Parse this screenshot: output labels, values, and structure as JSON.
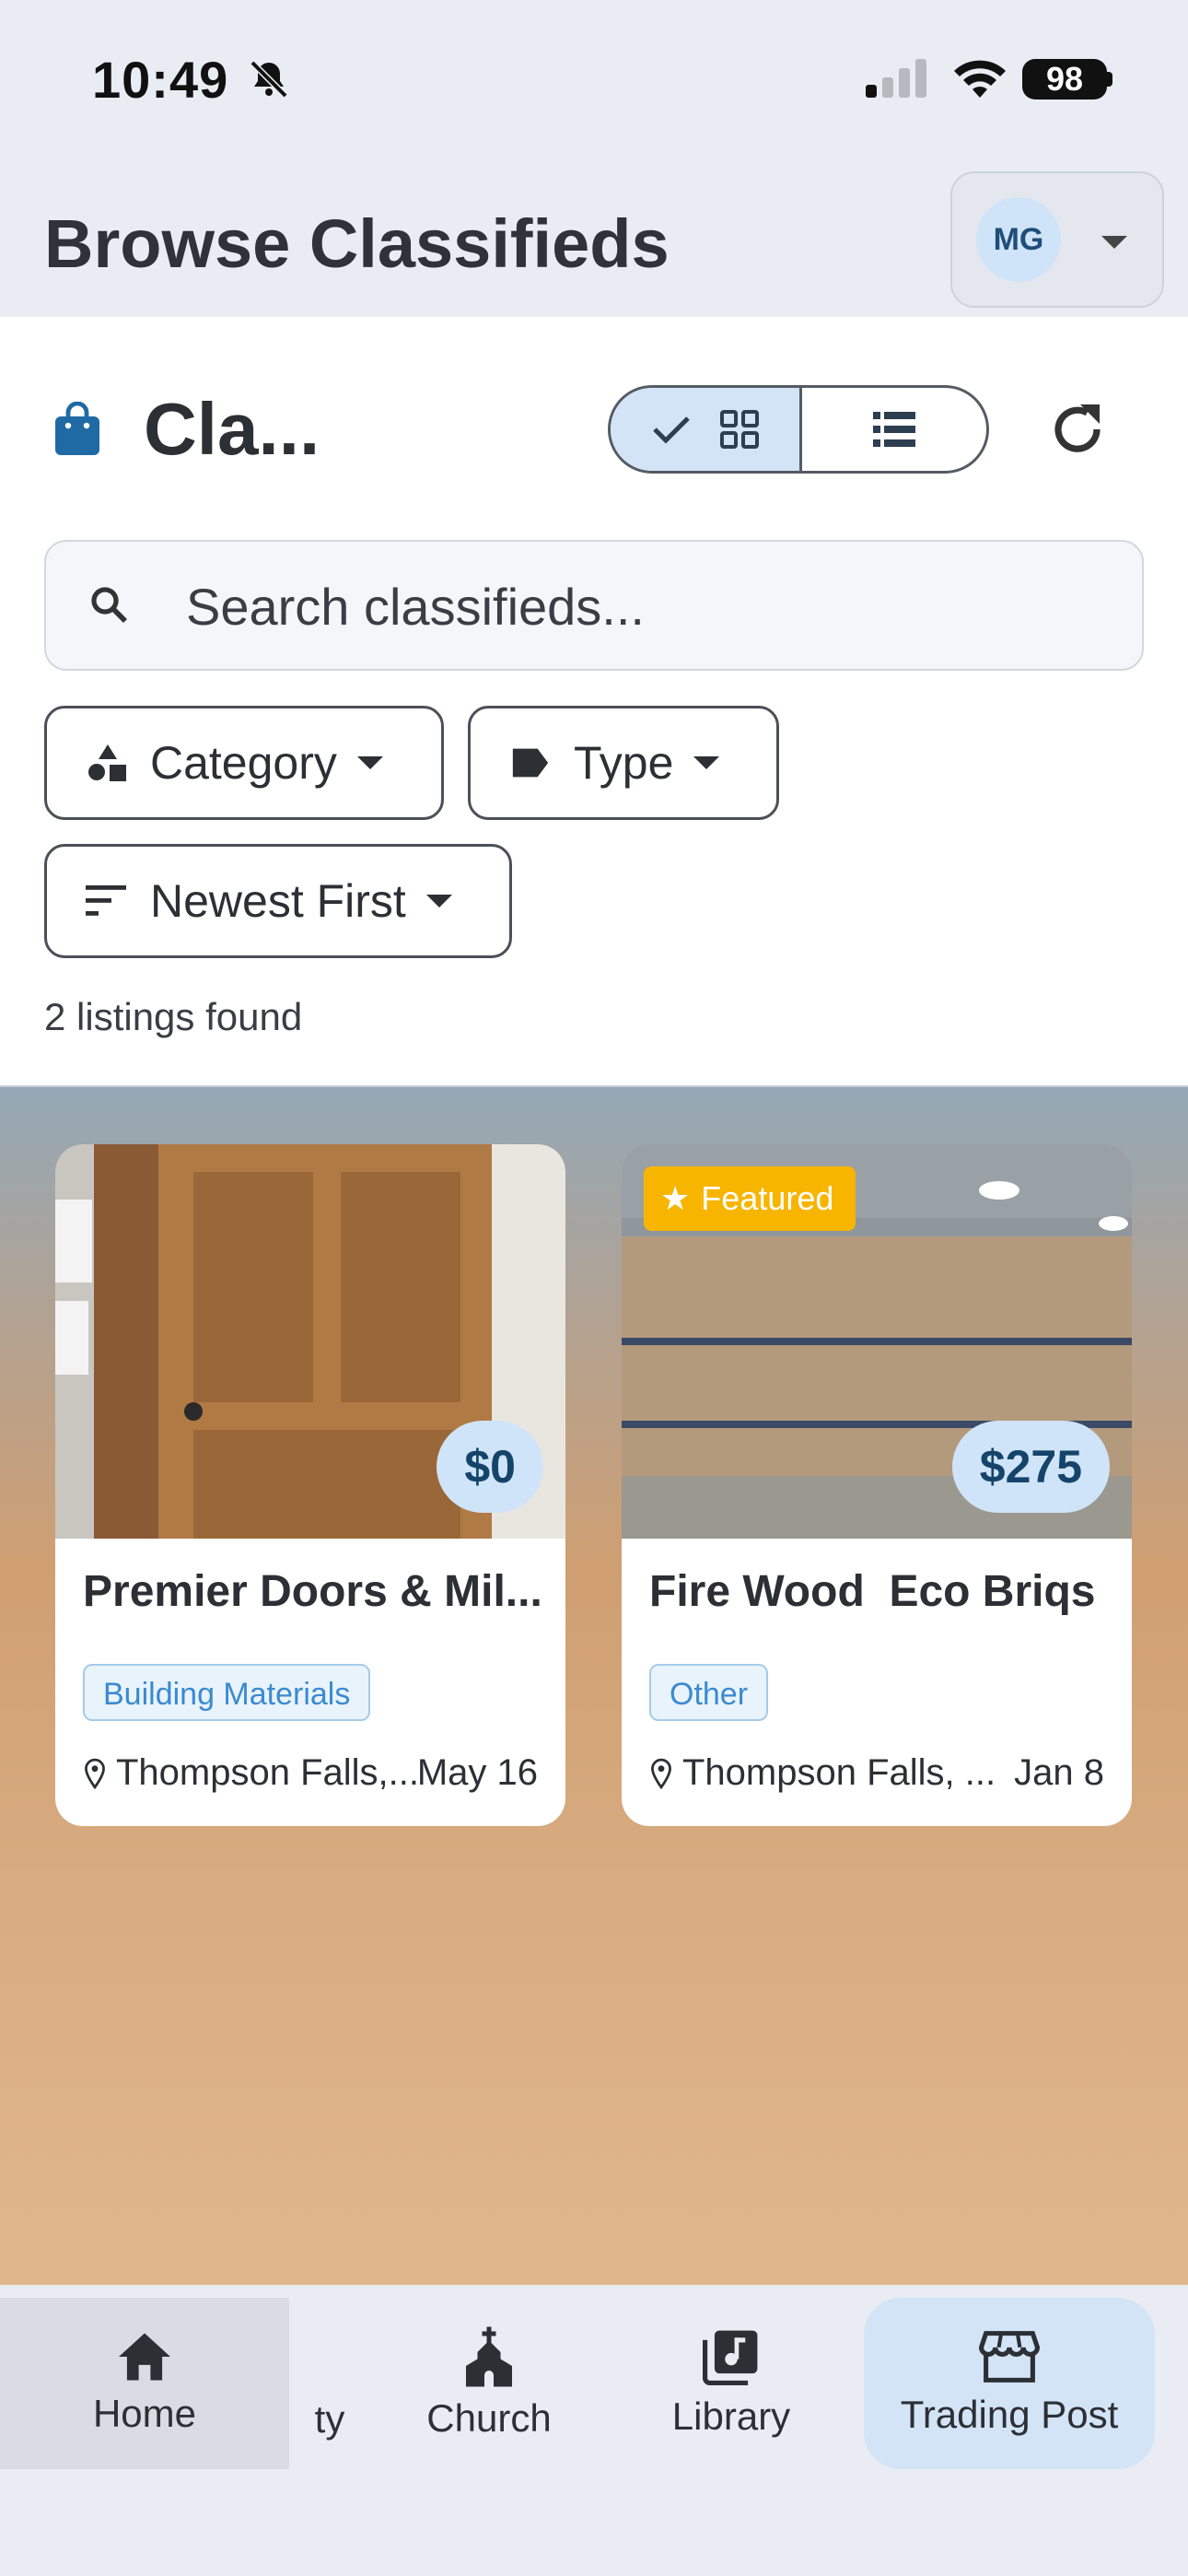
{
  "status_bar": {
    "time": "10:49",
    "battery": "98"
  },
  "header": {
    "title": "Browse Classifieds",
    "user_initials": "MG"
  },
  "section": {
    "title": "Cla..."
  },
  "search": {
    "placeholder": "Search classifieds..."
  },
  "filters": {
    "category": "Category",
    "type": "Type",
    "sort": "Newest First"
  },
  "results": {
    "count_text": "2 listings found"
  },
  "listings": [
    {
      "title": "Premier Doors & Mil...",
      "price": "$0",
      "tag": "Building Materials",
      "location": "Thompson Falls,...",
      "date": "May 16",
      "featured": false
    },
    {
      "title": "Fire Wood  Eco Briqs",
      "price": "$275",
      "tag": "Other",
      "location": "Thompson Falls, ...",
      "date": "Jan 8",
      "featured": true,
      "featured_label": "Featured"
    }
  ],
  "nav": {
    "home": "Home",
    "community_fragment": "ty",
    "church": "Church",
    "library": "Library",
    "trading_post": "Trading Post"
  },
  "colors": {
    "accent": "#cfe4f8",
    "featured": "#f7b500",
    "tag_text": "#3b8ad1",
    "bag_icon": "#1f6aa5"
  }
}
